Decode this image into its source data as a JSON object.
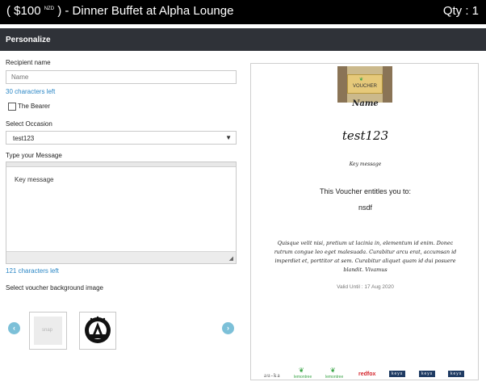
{
  "header": {
    "price_open": "( $100",
    "currency": "NZD",
    "title_rest": ") - Dinner Buffet at Alpha Lounge",
    "qty": "Qty : 1"
  },
  "section": {
    "title": "Personalize"
  },
  "form": {
    "recipient_label": "Recipient name",
    "recipient_placeholder": "Name",
    "recipient_chars_left": "30 characters left",
    "bearer_label": "The Bearer",
    "occasion_label": "Select Occasion",
    "occasion_value": "test123",
    "message_label": "Type your Message",
    "message_value": "Key message",
    "message_chars_left": "121 characters left",
    "bg_label": "Select voucher background image",
    "thumb1_text": "snap"
  },
  "preview": {
    "voucher_img_text": "VOUCHER",
    "name": "Name",
    "occasion": "test123",
    "message": "Key message",
    "entitles": "This Voucher entitles you to:",
    "item": "nsdf",
    "body": "Quisque velit nisi, pretium ut lacinia in, elementum id enim. Donec rutrum congue leo eget malesuada. Curabitur arcu erat, accumsan id imperdiet et, porttitor at sem. Curabitur aliquet quam id dui posuere blandit. Vivamus",
    "valid_until": "Valid Until : 17 Aug 2020",
    "logos": [
      "au-ka",
      "lemontree",
      "lemontree",
      "redfox",
      "keys",
      "keys",
      "keys"
    ]
  },
  "colors": {
    "topbar": "#000000",
    "section_bar": "#2f3238",
    "hint": "#2a86c5",
    "nav": "#7cc0d8",
    "redfox": "#d4242b",
    "lemon": "#3aa447"
  }
}
